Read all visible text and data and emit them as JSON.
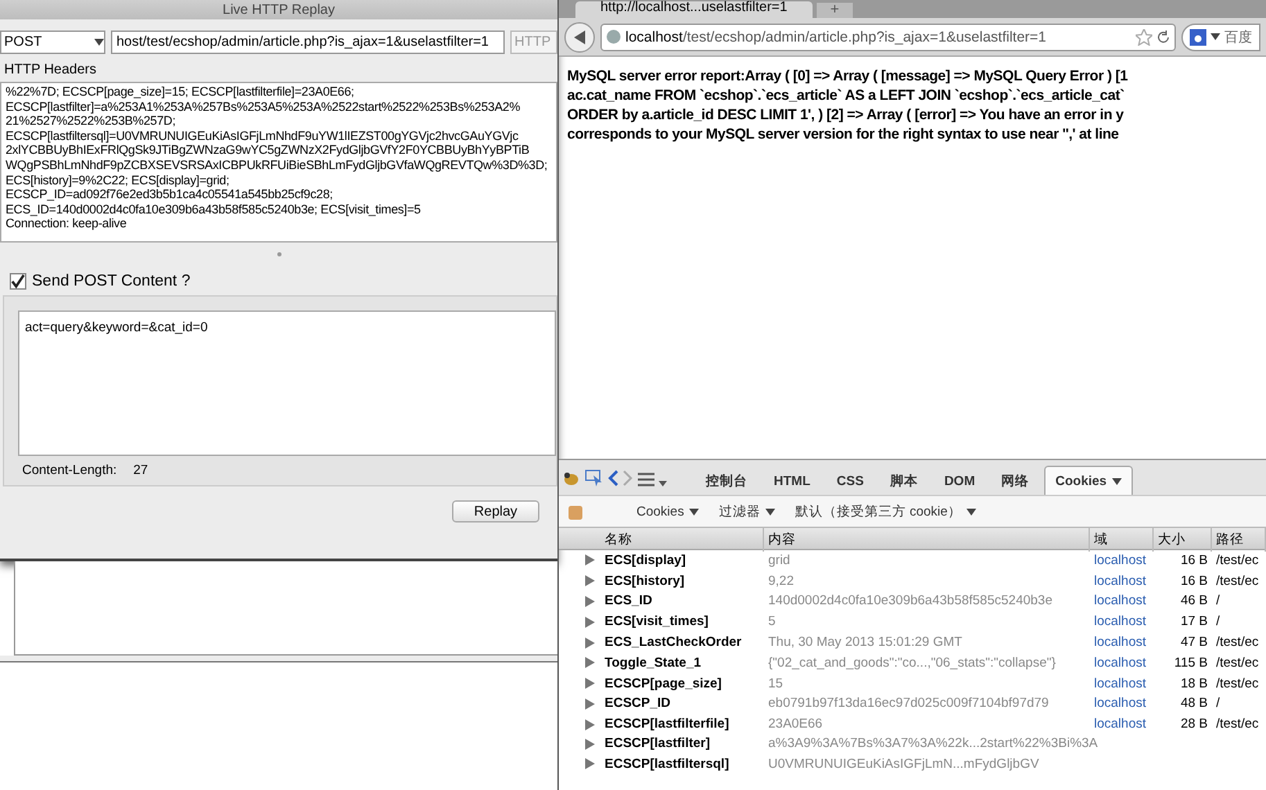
{
  "replay_window": {
    "title": "Live HTTP Replay",
    "method": "POST",
    "url": "host/test/ecshop/admin/article.php?is_ajax=1&uselastfilter=1",
    "http_button": "HTTP",
    "headers_label": "HTTP Headers",
    "header_lines": [
      "%22%7D; ECSCP[page_size]=15; ECSCP[lastfilterfile]=23A0E66;",
      "ECSCP[lastfilter]=a%253A1%253A%257Bs%253A5%253A%2522start%2522%253Bs%253A2%",
      "21%2527%2522%253B%257D;",
      "ECSCP[lastfiltersql]=U0VMRUNUIGEuKiAsIGFjLmNhdF9uYW1lIEZST00gYGVjc2hvcGAuYGVjc",
      "2xlYCBBUyBhIExFRlQgSk9JTiBgZWNzaG9wYC5gZWNzX2FydGljbGVfY2F0YCBBUyBhYyBPTiB",
      "WQgPSBhLmNhdF9pZCBXSEVSRSAxICBPUkRFUiBieSBhLmFydGljbGVfaWQgREVTQw%3D%3D;",
      "ECS[history]=9%2C22; ECS[display]=grid;",
      "ECSCP_ID=ad092f76e2ed3b5b1ca4c05541a545bb25cf9c28;",
      "ECS_ID=140d0002d4c0fa10e309b6a43b58f585c5240b3e; ECS[visit_times]=5",
      "Connection: keep-alive"
    ],
    "send_post": {
      "label": "Send POST Content ?",
      "checked": true
    },
    "post_content": "act=query&keyword=&cat_id=0",
    "content_length_label": "Content-Length:",
    "content_length": "27",
    "replay_button": "Replay"
  },
  "browser": {
    "tab_title": "http://localhost...uselastfilter=1",
    "new_tab": "+",
    "url_host": "localhost",
    "url_path": "/test/ecshop/admin/article.php?is_ajax=1&uselastfilter=1",
    "search_engine": "百度",
    "error_lines": [
      "MySQL server error report:Array ( [0] => Array ( [message] => MySQL Query Error ) [1",
      "ac.cat_name FROM `ecshop`.`ecs_article` AS a LEFT JOIN `ecshop`.`ecs_article_cat`",
      "ORDER by a.article_id DESC LIMIT 1', ) [2] => Array ( [error] => You have an error in y",
      "corresponds to your MySQL server version for the right syntax to use near '',' at line"
    ]
  },
  "firebug": {
    "tabs": [
      {
        "label": "控制台",
        "selected": false
      },
      {
        "label": "HTML",
        "selected": false
      },
      {
        "label": "CSS",
        "selected": false
      },
      {
        "label": "脚本",
        "selected": false
      },
      {
        "label": "DOM",
        "selected": false
      },
      {
        "label": "网络",
        "selected": false
      },
      {
        "label": "Cookies",
        "selected": true
      }
    ],
    "sub_menus": [
      "Cookies",
      "过滤器",
      "默认（接受第三方 cookie）"
    ],
    "columns": [
      "名称",
      "内容",
      "域",
      "大小",
      "路径"
    ],
    "rows": [
      {
        "name": "ECS[display]",
        "value": "grid",
        "domain": "localhost",
        "size": "16 B",
        "path": "/test/ec"
      },
      {
        "name": "ECS[history]",
        "value": "9,22",
        "domain": "localhost",
        "size": "16 B",
        "path": "/test/ec"
      },
      {
        "name": "ECS_ID",
        "value": "140d0002d4c0fa10e309b6a43b58f585c5240b3e",
        "domain": "localhost",
        "size": "46 B",
        "path": "/"
      },
      {
        "name": "ECS[visit_times]",
        "value": "5",
        "domain": "localhost",
        "size": "17 B",
        "path": "/"
      },
      {
        "name": "ECS_LastCheckOrder",
        "value": "Thu, 30 May 2013 15:01:29 GMT",
        "domain": "localhost",
        "size": "47 B",
        "path": "/test/ec"
      },
      {
        "name": "Toggle_State_1",
        "value": "{\"02_cat_and_goods\":\"co...,\"06_stats\":\"collapse\"}",
        "domain": "localhost",
        "size": "115 B",
        "path": "/test/ec"
      },
      {
        "name": "ECSCP[page_size]",
        "value": "15",
        "domain": "localhost",
        "size": "18 B",
        "path": "/test/ec"
      },
      {
        "name": "ECSCP_ID",
        "value": "eb0791b97f13da16ec97d025c009f7104bf97d79",
        "domain": "localhost",
        "size": "48 B",
        "path": "/"
      },
      {
        "name": "ECSCP[lastfilterfile]",
        "value": "23A0E66",
        "domain": "localhost",
        "size": "28 B",
        "path": "/test/ec"
      },
      {
        "name": "ECSCP[lastfilter]",
        "value": "a%3A9%3A%7Bs%3A7%3A%22k...2start%22%3Bi%3A"
      },
      {
        "name": "ECSCP[lastfiltersql]",
        "value": "U0VMRUNUIGEuKiAsIGFjLmN...mFydGljbGV"
      }
    ]
  }
}
